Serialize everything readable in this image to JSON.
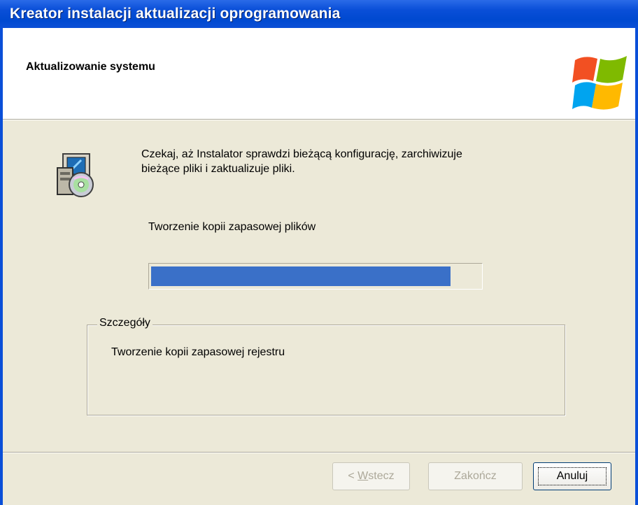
{
  "window": {
    "title": "Kreator instalacji aktualizacji oprogramowania"
  },
  "header": {
    "title": "Aktualizowanie systemu"
  },
  "main": {
    "intro_line1": "Czekaj, aż Instalator sprawdzi bieżącą konfigurację, zarchiwizuje",
    "intro_line2": "bieżące pliki i zaktualizuje pliki.",
    "status": "Tworzenie kopii zapasowej plików",
    "progress": 0.91
  },
  "details": {
    "legend": "Szczegóły",
    "text": "Tworzenie kopii zapasowej rejestru"
  },
  "buttons": {
    "back_prefix": "< ",
    "back_mnemonic": "W",
    "back_rest": "stecz",
    "finish": "Zakończ",
    "cancel": "Anuluj"
  },
  "colors": {
    "titlebar": "#0A4FD8",
    "progress_fill": "#3A70C8",
    "dialog_bg": "#ECE9D8"
  },
  "icons": [
    "windows-logo-icon",
    "setup-installer-icon"
  ]
}
